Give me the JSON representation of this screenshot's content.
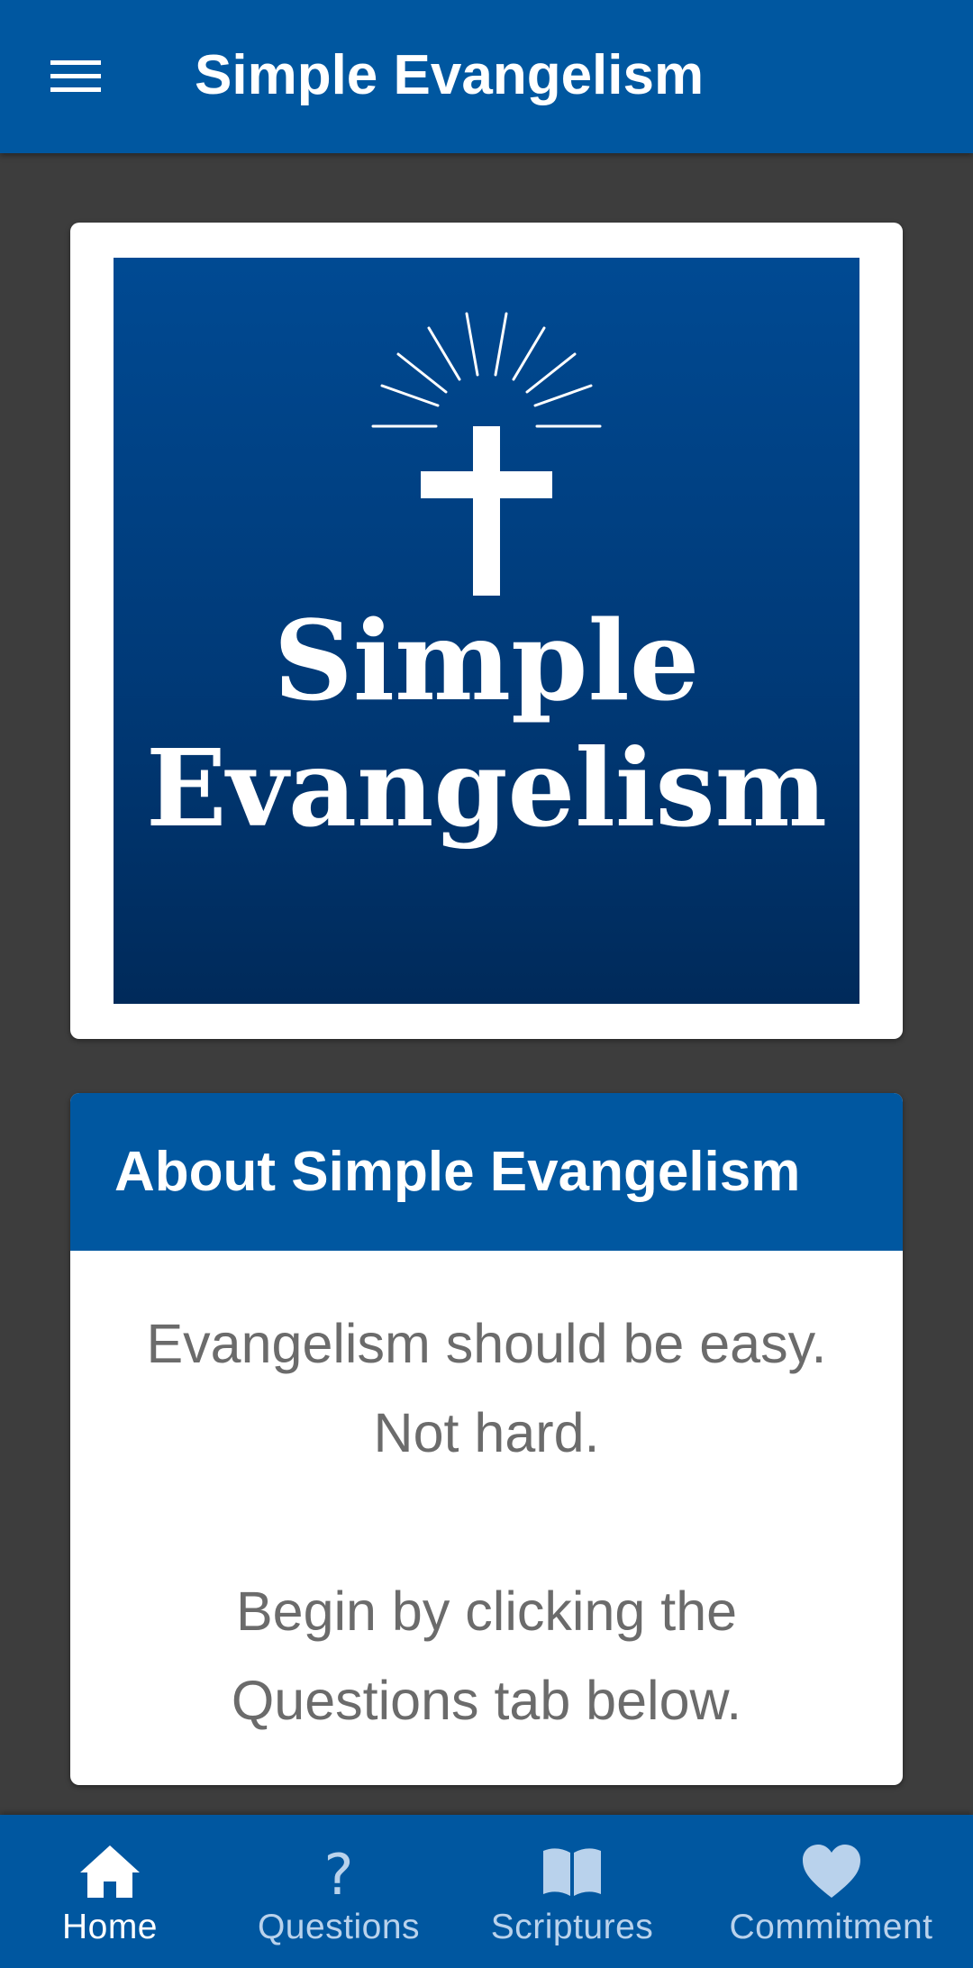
{
  "app_bar": {
    "title": "Simple Evangelism",
    "menu_icon": "hamburger-menu-icon"
  },
  "logo": {
    "line1": "Simple",
    "line2": "Evangelism",
    "icon": "cross-with-rays-icon"
  },
  "about": {
    "title": "About Simple Evangelism",
    "lines": [
      "Evangelism should be easy.",
      "Not hard.",
      "Begin by clicking the",
      "Questions tab below."
    ]
  },
  "bottom_nav": {
    "items": [
      {
        "label": "Home",
        "icon": "home-icon",
        "active": true
      },
      {
        "label": "Questions",
        "icon": "question-mark-icon",
        "active": false
      },
      {
        "label": "Scriptures",
        "icon": "open-book-icon",
        "active": false
      },
      {
        "label": "Commitment",
        "icon": "heart-icon",
        "active": false
      }
    ]
  },
  "colors": {
    "primary": "#0057a0",
    "background": "#3d3d3d",
    "card": "#ffffff",
    "body_text": "#6b6b6b",
    "nav_inactive": "#b9d2ec"
  }
}
